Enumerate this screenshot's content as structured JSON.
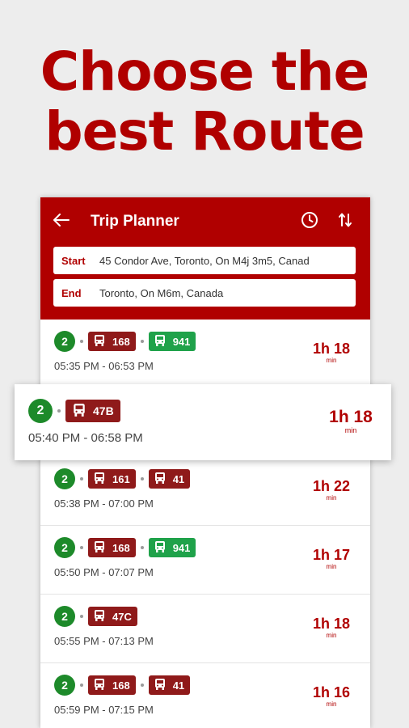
{
  "headline": {
    "line1": "Choose the",
    "line2": "best Route"
  },
  "appbar": {
    "title": "Trip Planner",
    "icons": [
      "back-arrow-icon",
      "clock-icon",
      "swap-vertical-icon"
    ]
  },
  "fields": {
    "start_label": "Start",
    "start_value": "45 Condor Ave, Toronto, On M4j 3m5, Canad",
    "end_label": "End",
    "end_value": "Toronto, On M6m, Canada"
  },
  "colors": {
    "brand": "#b00000",
    "transfer_badge": "#1d8a2a",
    "bus_route": "#8f1a1a",
    "express_route": "#1fa24a"
  },
  "routes": [
    {
      "transfers": "2",
      "legs": [
        {
          "num": "168",
          "color": "red"
        },
        {
          "num": "941",
          "color": "green"
        }
      ],
      "times": "05:35 PM - 06:53 PM",
      "duration": "1h 18",
      "unit": "min"
    },
    {
      "transfers": "2",
      "legs": [
        {
          "num": "47B",
          "color": "red"
        }
      ],
      "times": "05:40 PM - 06:58 PM",
      "duration": "1h 18",
      "unit": "min"
    },
    {
      "transfers": "2",
      "legs": [
        {
          "num": "161",
          "color": "red"
        },
        {
          "num": "41",
          "color": "red"
        }
      ],
      "times": "05:38 PM - 07:00 PM",
      "duration": "1h 22",
      "unit": "min"
    },
    {
      "transfers": "2",
      "legs": [
        {
          "num": "168",
          "color": "red"
        },
        {
          "num": "941",
          "color": "green"
        }
      ],
      "times": "05:50 PM - 07:07 PM",
      "duration": "1h 17",
      "unit": "min"
    },
    {
      "transfers": "2",
      "legs": [
        {
          "num": "47C",
          "color": "red"
        }
      ],
      "times": "05:55 PM - 07:13 PM",
      "duration": "1h 18",
      "unit": "min"
    },
    {
      "transfers": "2",
      "legs": [
        {
          "num": "168",
          "color": "red"
        },
        {
          "num": "41",
          "color": "red"
        }
      ],
      "times": "05:59 PM - 07:15 PM",
      "duration": "1h 16",
      "unit": "min"
    }
  ]
}
